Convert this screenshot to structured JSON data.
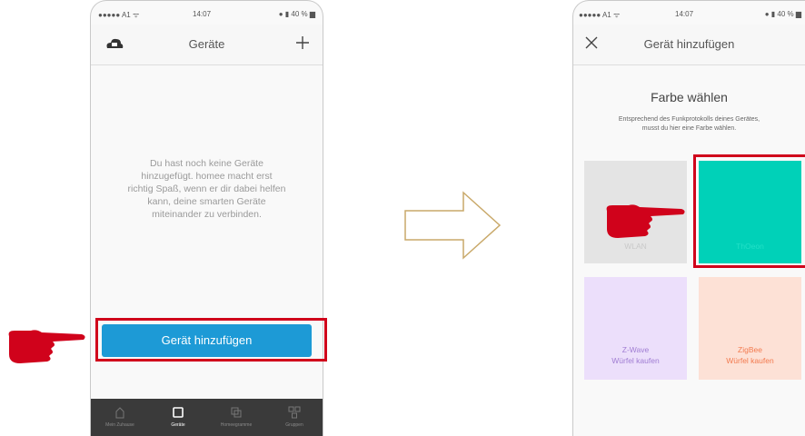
{
  "phone1": {
    "status": {
      "carrier": "●●●●● A1 ᯤ",
      "time": "14:07",
      "battery": "● ▮ 40 % ▆"
    },
    "nav": {
      "title": "Geräte",
      "left_icon": "cloud-logo-icon",
      "right_icon": "plus-icon"
    },
    "empty_message": "Du hast noch keine Geräte\nhinzugefügt. homee macht erst\nrichtig Spaß, wenn er dir dabei helfen\nkann, deine smarten Geräte\nmiteinander zu verbinden.",
    "add_button_label": "Gerät hinzufügen",
    "tabs": [
      {
        "label": "Mein Zuhause",
        "icon": "home-icon"
      },
      {
        "label": "Geräte",
        "icon": "device-icon"
      },
      {
        "label": "Homeegramme",
        "icon": "homeegram-icon"
      },
      {
        "label": "Gruppen",
        "icon": "groups-icon"
      }
    ]
  },
  "phone2": {
    "status": {
      "carrier": "●●●●● A1 ᯤ",
      "time": "14:07",
      "battery": "● ▮ 40 % ▆"
    },
    "nav": {
      "title": "Gerät hinzufügen",
      "left_icon": "close-icon"
    },
    "heading": "Farbe wählen",
    "description": "Entsprechend des Funkprotokolls deines Gerätes,\nmusst du hier eine Farbe wählen.",
    "tiles": [
      {
        "label": "WLAN",
        "bg": "#e4e4e4",
        "color": "#c9c9c9"
      },
      {
        "label": "ThOeon",
        "bg": "#00d1b8",
        "color": "#22e0c7"
      },
      {
        "label": "Z-Wave\nWürfel kaufen",
        "bg": "#ecdffb",
        "color": "#a07dd3"
      },
      {
        "label": "ZigBee\nWürfel kaufen",
        "bg": "#fde1d6",
        "color": "#f27a4f"
      }
    ]
  },
  "colors": {
    "accent_blue": "#1d9ad6",
    "highlight_red": "#d0021b",
    "arrow": "#c9a96a"
  }
}
